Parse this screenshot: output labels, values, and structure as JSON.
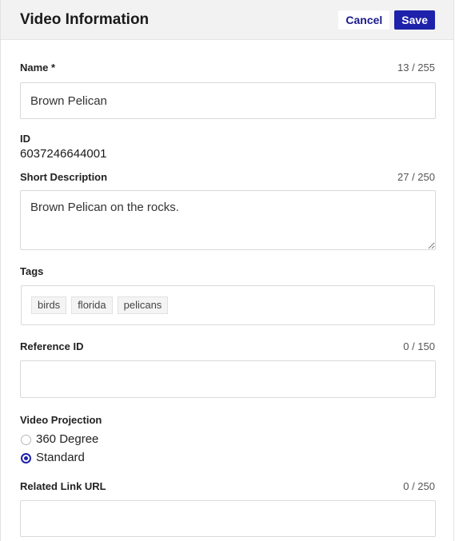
{
  "header": {
    "title": "Video Information",
    "cancel_label": "Cancel",
    "save_label": "Save"
  },
  "name": {
    "label": "Name *",
    "counter": "13 / 255",
    "value": "Brown Pelican"
  },
  "id": {
    "label": "ID",
    "value": "6037246644001"
  },
  "short_description": {
    "label": "Short Description",
    "counter": "27 / 250",
    "value": "Brown Pelican on the rocks."
  },
  "tags": {
    "label": "Tags",
    "items": [
      "birds",
      "florida",
      "pelicans"
    ]
  },
  "reference_id": {
    "label": "Reference ID",
    "counter": "0 / 150",
    "value": ""
  },
  "video_projection": {
    "label": "Video Projection",
    "options": [
      {
        "label": "360 Degree",
        "selected": false
      },
      {
        "label": "Standard",
        "selected": true
      }
    ]
  },
  "related_link_url": {
    "label": "Related Link URL",
    "counter": "0 / 250",
    "value": ""
  },
  "colors": {
    "accent": "#1e22aa",
    "header_bg": "#f2f2f2"
  }
}
